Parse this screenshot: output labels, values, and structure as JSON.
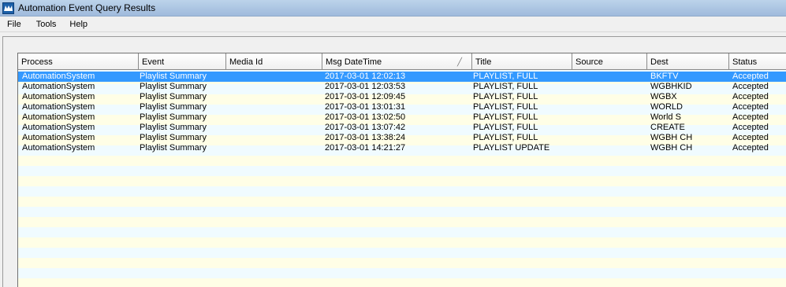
{
  "window": {
    "title": "Automation Event Query Results",
    "icon": "app-logo-icon"
  },
  "menu": [
    "File",
    "Tools",
    "Help"
  ],
  "table": {
    "columns": [
      "Process",
      "Event",
      "Media Id",
      "Msg DateTime",
      "Title",
      "Source",
      "Dest",
      "Status"
    ],
    "sorted_column": "Msg DateTime",
    "selected_row": 0,
    "rows": [
      [
        "AutomationSystem",
        "Playlist Summary",
        "",
        "2017-03-01 12:02:13",
        "PLAYLIST, FULL",
        "",
        "BKFTV",
        "Accepted"
      ],
      [
        "AutomationSystem",
        "Playlist Summary",
        "",
        "2017-03-01 12:03:53",
        "PLAYLIST, FULL",
        "",
        "WGBHKID",
        "Accepted"
      ],
      [
        "AutomationSystem",
        "Playlist Summary",
        "",
        "2017-03-01 12:09:45",
        "PLAYLIST, FULL",
        "",
        "WGBX",
        "Accepted"
      ],
      [
        "AutomationSystem",
        "Playlist Summary",
        "",
        "2017-03-01 13:01:31",
        "PLAYLIST, FULL",
        "",
        "WORLD",
        "Accepted"
      ],
      [
        "AutomationSystem",
        "Playlist Summary",
        "",
        "2017-03-01 13:02:50",
        "PLAYLIST, FULL",
        "",
        "World S",
        "Accepted"
      ],
      [
        "AutomationSystem",
        "Playlist Summary",
        "",
        "2017-03-01 13:07:42",
        "PLAYLIST, FULL",
        "",
        "CREATE",
        "Accepted"
      ],
      [
        "AutomationSystem",
        "Playlist Summary",
        "",
        "2017-03-01 13:38:24",
        "PLAYLIST, FULL",
        "",
        "WGBH CH",
        "Accepted"
      ],
      [
        "AutomationSystem",
        "Playlist Summary",
        "",
        "2017-03-01 14:21:27",
        "PLAYLIST UPDATE",
        "",
        "WGBH CH",
        "Accepted"
      ]
    ]
  },
  "colors": {
    "selection": "#3399ff",
    "row_even": "#fffee6",
    "row_odd": "#f0fbff",
    "titlebar": "#bcd3ea"
  }
}
